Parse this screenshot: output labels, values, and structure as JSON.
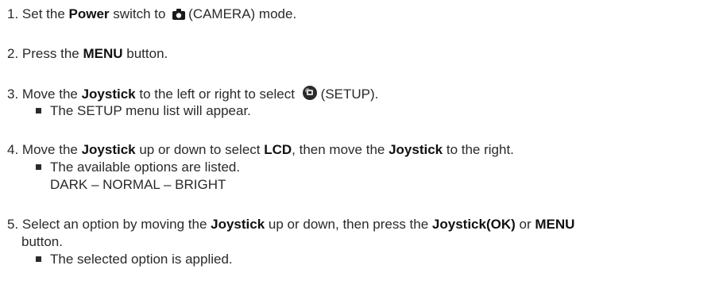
{
  "step1": {
    "num": "1.",
    "a": "Set the ",
    "b1": "Power",
    "c": " switch to ",
    "icon": "camera-icon",
    "d": "(CAMERA) mode."
  },
  "step2": {
    "num": "2.",
    "a": "Press the ",
    "b1": "MENU",
    "c": " button."
  },
  "step3": {
    "num": "3.",
    "a": "Move the ",
    "b1": "Joystick",
    "c": " to the left or right to select ",
    "icon": "setup-icon",
    "d": "(SETUP).",
    "bullet": "The SETUP menu list will appear."
  },
  "step4": {
    "num": "4.",
    "a": "Move the ",
    "b1": "Joystick",
    "c": " up or down to select ",
    "b2": "LCD",
    "d": ", then move the ",
    "b3": "Joystick",
    "e": " to the right.",
    "bullet": "The available options are listed.",
    "options": "DARK – NORMAL – BRIGHT"
  },
  "step5": {
    "num": "5.",
    "a": "Select an option by moving the ",
    "b1": "Joystick",
    "c": " up or down, then press the ",
    "b2": "Joystick(OK)",
    "d": " or ",
    "b3": "MENU",
    "cont": "button.",
    "bullet": "The selected option is applied."
  }
}
